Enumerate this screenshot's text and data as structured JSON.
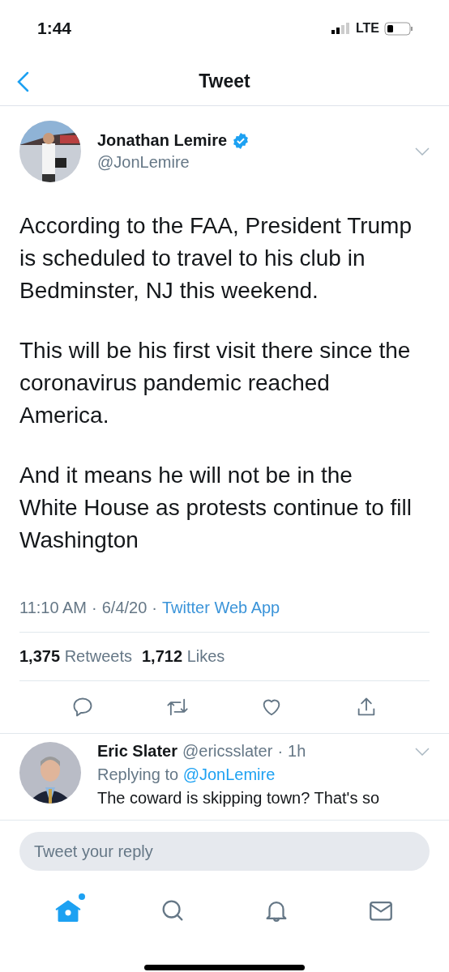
{
  "status_bar": {
    "time": "1:44",
    "network": "LTE"
  },
  "nav": {
    "title": "Tweet"
  },
  "tweet": {
    "author": {
      "name": "Jonathan Lemire",
      "handle": "@JonLemire",
      "verified": true
    },
    "paragraphs": [
      "According to the FAA, President Trump is scheduled to travel to his club in Bedminster, NJ this weekend.",
      "This will be his first visit there since the coronavirus pandemic reached America.",
      "And it means he will not be in the White House as protests continue to fill Washington"
    ],
    "time": "11:10 AM",
    "separator_1": "·",
    "date": "6/4/20",
    "separator_2": "·",
    "source": "Twitter Web App",
    "stats": [
      {
        "count": "1,375",
        "label": "Retweets"
      },
      {
        "count": "1,712",
        "label": "Likes"
      }
    ],
    "actions": [
      {
        "kind": "reply"
      },
      {
        "kind": "retweet"
      },
      {
        "kind": "like"
      },
      {
        "kind": "share"
      }
    ]
  },
  "reply": {
    "name": "Eric Slater",
    "handle": "@ericsslater",
    "separator": "·",
    "age": "1h",
    "replying_label": "Replying to",
    "replying_to": "@JonLemire",
    "text": "The coward is skipping town? That's so"
  },
  "composer": {
    "placeholder": "Tweet your reply"
  },
  "tabs": [
    {
      "kind": "home",
      "selected": true,
      "dot": true
    },
    {
      "kind": "search",
      "selected": false,
      "dot": false
    },
    {
      "kind": "notifications",
      "selected": false,
      "dot": false
    },
    {
      "kind": "messages",
      "selected": false,
      "dot": false
    }
  ]
}
